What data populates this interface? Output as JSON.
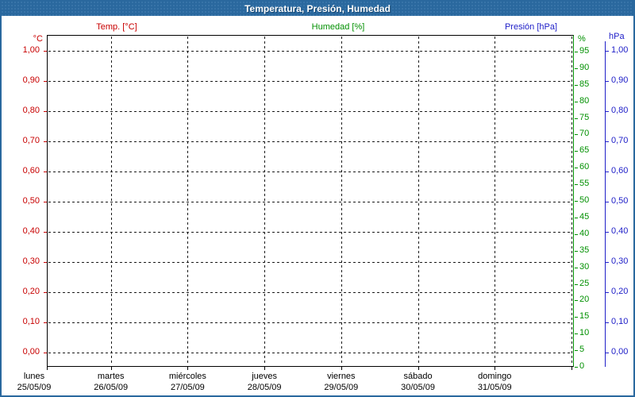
{
  "window": {
    "title": "Temperatura, Presión, Humedad"
  },
  "chart_data": {
    "type": "line",
    "title": "Temperatura, Presión, Humedad",
    "grid": "dashed, on",
    "legend_position": "top",
    "series": [
      {
        "name": "Temp. [°C]",
        "color": "#c80000",
        "axis": "left_c",
        "values": []
      },
      {
        "name": "Humedad [%]",
        "color": "#009000",
        "axis": "right_pct",
        "values": []
      },
      {
        "name": "Presión [hPa]",
        "color": "#2020c8",
        "axis": "right_hpa",
        "values": []
      }
    ],
    "axes": {
      "left_c": {
        "unit": "°C",
        "range": [
          0.0,
          1.0
        ],
        "tick_labels": [
          "1,00",
          "0,90",
          "0,80",
          "0,70",
          "0,60",
          "0,50",
          "0,40",
          "0,30",
          "0,20",
          "0,10",
          "0,00"
        ]
      },
      "right_pct": {
        "unit": "%",
        "range": [
          0,
          100
        ],
        "tick_values": [
          95,
          90,
          85,
          80,
          75,
          70,
          65,
          60,
          55,
          50,
          45,
          40,
          35,
          30,
          25,
          20,
          15,
          10,
          5,
          0
        ]
      },
      "right_hpa": {
        "unit": "hPa",
        "range": [
          0.0,
          1.0
        ],
        "tick_labels": [
          "1,00",
          "0,90",
          "0,80",
          "0,70",
          "0,60",
          "0,50",
          "0,40",
          "0,30",
          "0,20",
          "0,10",
          "0,00"
        ]
      }
    },
    "x_axis": {
      "days": [
        {
          "name": "lunes",
          "date": "25/05/09"
        },
        {
          "name": "martes",
          "date": "26/05/09"
        },
        {
          "name": "miércoles",
          "date": "27/05/09"
        },
        {
          "name": "jueves",
          "date": "28/05/09"
        },
        {
          "name": "viernes",
          "date": "29/05/09"
        },
        {
          "name": "sábado",
          "date": "30/05/09"
        },
        {
          "name": "domingo",
          "date": "31/05/09"
        }
      ]
    }
  },
  "colors": {
    "temp": "#c80000",
    "humidity": "#009000",
    "pressure": "#2020c8",
    "titlebar": "#2a689e",
    "grid": "#1a1a1a"
  }
}
